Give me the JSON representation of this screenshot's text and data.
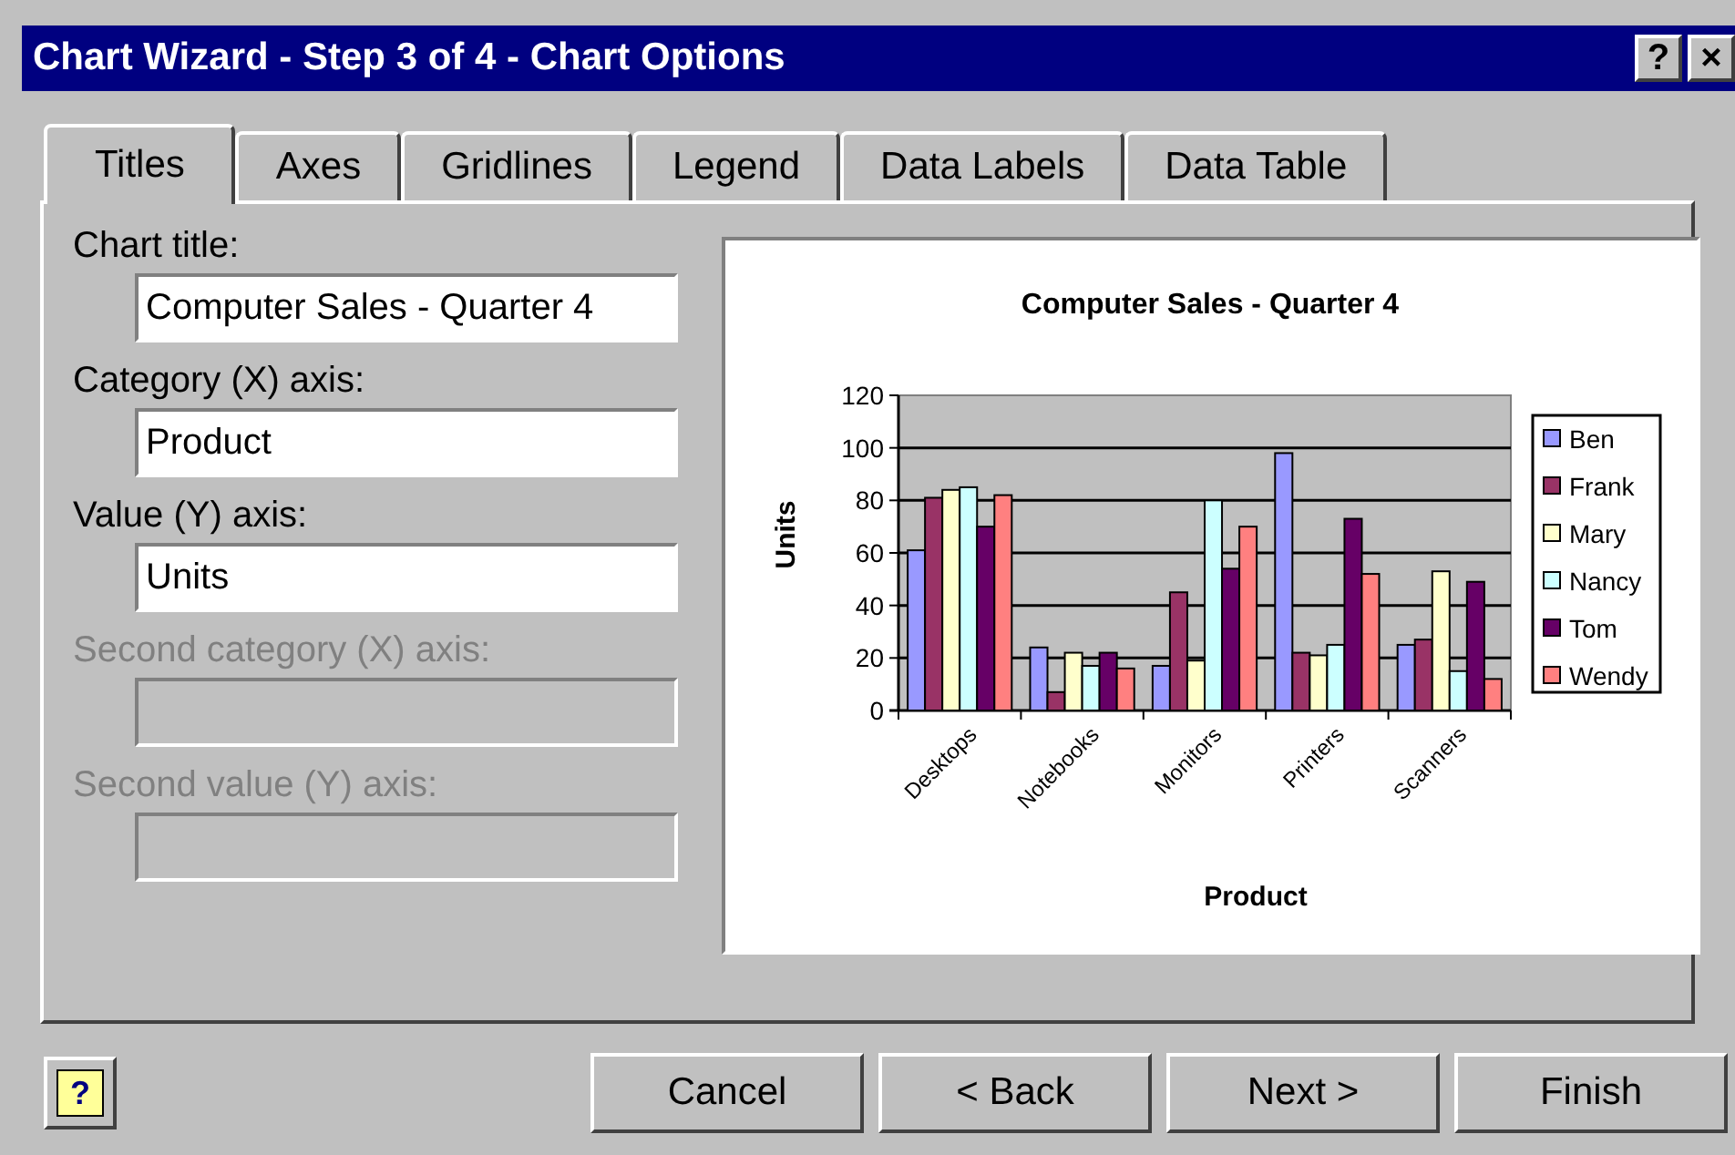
{
  "window": {
    "title": "Chart Wizard - Step 3 of 4 - Chart Options",
    "title_buttons": [
      "?",
      "×"
    ]
  },
  "tabs": [
    {
      "label": "Titles",
      "selected": true
    },
    {
      "label": "Axes",
      "selected": false
    },
    {
      "label": "Gridlines",
      "selected": false
    },
    {
      "label": "Legend",
      "selected": false
    },
    {
      "label": "Data Labels",
      "selected": false
    },
    {
      "label": "Data Table",
      "selected": false
    }
  ],
  "fields": [
    {
      "label": "Chart title:",
      "value": "Computer Sales - Quarter 4",
      "disabled": false
    },
    {
      "label": "Category (X) axis:",
      "value": "Product",
      "disabled": false
    },
    {
      "label": "Value (Y) axis:",
      "value": "Units",
      "disabled": false
    },
    {
      "label": "Second category (X) axis:",
      "disabled": true
    },
    {
      "label": "Second value (Y) axis:",
      "disabled": true
    }
  ],
  "preview": {
    "chart_data": {
      "type": "bar",
      "title": "Computer Sales - Quarter 4",
      "xlabel": "Product",
      "ylabel": "Units",
      "categories": [
        "Desktops",
        "Notebooks",
        "Monitors",
        "Printers",
        "Scanners"
      ],
      "ylim": [
        0,
        120
      ],
      "grid": true,
      "legend": true,
      "yticks": [
        0,
        20,
        40,
        60,
        80,
        100,
        120
      ],
      "series": [
        {
          "name": "Ben",
          "color": "#9999ff",
          "values": [
            61,
            24,
            17,
            98,
            25
          ]
        },
        {
          "name": "Frank",
          "color": "#993366",
          "values": [
            81,
            7,
            45,
            22,
            27
          ]
        },
        {
          "name": "Mary",
          "color": "#ffffcc",
          "values": [
            84,
            22,
            19,
            21,
            53
          ]
        },
        {
          "name": "Nancy",
          "color": "#ccffff",
          "values": [
            85,
            17,
            80,
            25,
            15
          ]
        },
        {
          "name": "Tom",
          "color": "#660066",
          "values": [
            70,
            22,
            54,
            73,
            49
          ]
        },
        {
          "name": "Wendy",
          "color": "#ff8080",
          "values": [
            82,
            16,
            70,
            52,
            12
          ]
        }
      ]
    }
  },
  "buttons": [
    {
      "label": "Cancel"
    },
    {
      "label": "< Back"
    },
    {
      "label": "Next >"
    },
    {
      "label": "Finish"
    }
  ],
  "help_button": {
    "label": "?"
  }
}
